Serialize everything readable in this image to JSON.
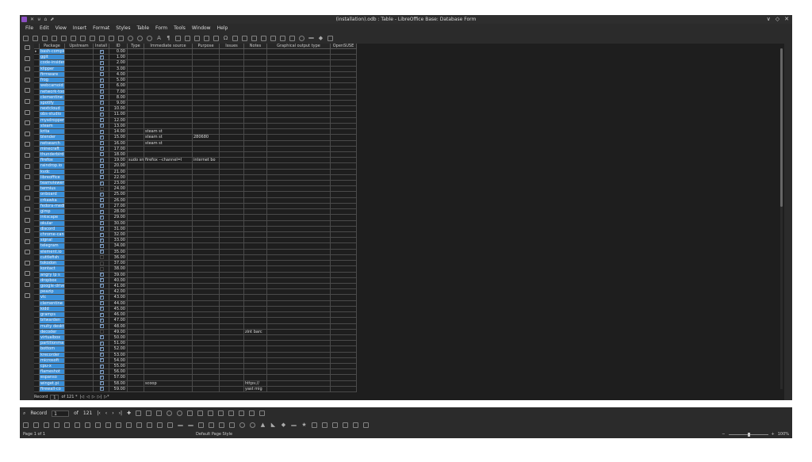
{
  "window": {
    "title": "(installation).odb : Table - LibreOffice Base: Database Form",
    "controls": [
      "∨",
      "◇",
      "✕"
    ]
  },
  "menu": [
    "File",
    "Edit",
    "View",
    "Insert",
    "Format",
    "Styles",
    "Table",
    "Form",
    "Tools",
    "Window",
    "Help"
  ],
  "table": {
    "columns": [
      "Package",
      "Upstream",
      "Install",
      "ID",
      "Type",
      "Immediate source",
      "Purpose",
      "Issues",
      "Notes",
      "Graphical output type",
      "OpenSUSE"
    ],
    "rows": [
      {
        "package": "bash-completion",
        "install": true,
        "id": "0.00"
      },
      {
        "package": "ggit",
        "install": true,
        "id": "1.00"
      },
      {
        "package": "code-insiders",
        "install": true,
        "id": "2.00"
      },
      {
        "package": "klipper",
        "install": true,
        "id": "3.00"
      },
      {
        "package": "firmware",
        "install": true,
        "id": "4.00"
      },
      {
        "package": "frog",
        "install": true,
        "id": "5.00"
      },
      {
        "package": "webcamoid",
        "install": true,
        "id": "6.00"
      },
      {
        "package": "network-tools",
        "install": true,
        "id": "7.00"
      },
      {
        "package": "clementine",
        "install": true,
        "id": "8.00"
      },
      {
        "package": "spotify",
        "install": true,
        "id": "9.00"
      },
      {
        "package": "nextcloud",
        "install": true,
        "id": "10.00"
      },
      {
        "package": "obs-studio",
        "install": true,
        "id": "11.00"
      },
      {
        "package": "mysdropper",
        "install": true,
        "id": "12.00"
      },
      {
        "package": "steam",
        "install": true,
        "id": "13.00"
      },
      {
        "package": "krita",
        "install": true,
        "id": "14.00",
        "source": "steam st"
      },
      {
        "package": "blender",
        "install": true,
        "id": "15.00",
        "source": "steam st",
        "purpose": "280680"
      },
      {
        "package": "netsearch",
        "install": true,
        "id": "16.00",
        "source": "steam st"
      },
      {
        "package": "minecraft",
        "install": true,
        "id": "17.00"
      },
      {
        "package": "thunderbird",
        "install": true,
        "id": "18.00"
      },
      {
        "package": "firefox",
        "install": true,
        "id": "19.00",
        "type": "sudo sn",
        "source": "firefox --channel=l",
        "purpose": "internet bo"
      },
      {
        "package": "raindrop.io",
        "install": true,
        "id": "20.00"
      },
      {
        "package": "kvdc",
        "install": true,
        "id": "21.00"
      },
      {
        "package": "libreoffice",
        "install": true,
        "id": "22.00"
      },
      {
        "package": "teamviewer",
        "install": true,
        "id": "23.00"
      },
      {
        "package": "termius",
        "install": false,
        "id": "24.00"
      },
      {
        "package": "onboard",
        "install": true,
        "id": "25.00"
      },
      {
        "package": "crkawka",
        "install": true,
        "id": "26.00"
      },
      {
        "package": "fedora-media",
        "install": true,
        "id": "27.00"
      },
      {
        "package": "gimp",
        "install": true,
        "id": "28.00"
      },
      {
        "package": "inkscape",
        "install": true,
        "id": "29.00"
      },
      {
        "package": "okular",
        "install": true,
        "id": "30.00"
      },
      {
        "package": "discord",
        "install": true,
        "id": "31.00"
      },
      {
        "package": "chrome-canary",
        "install": true,
        "id": "32.00"
      },
      {
        "package": "signal",
        "install": true,
        "id": "33.00"
      },
      {
        "package": "telegram",
        "install": true,
        "id": "34.00"
      },
      {
        "package": "element.io",
        "install": true,
        "id": "35.00"
      },
      {
        "package": "cuttlefish",
        "install": false,
        "id": "36.00"
      },
      {
        "package": "tokodon",
        "install": false,
        "id": "37.00"
      },
      {
        "package": "kontact",
        "install": false,
        "id": "38.00"
      },
      {
        "package": "angry ip s",
        "install": true,
        "id": "39.00"
      },
      {
        "package": "dropbox",
        "install": true,
        "id": "40.00"
      },
      {
        "package": "google-drive",
        "install": true,
        "id": "41.00"
      },
      {
        "package": "peazip",
        "install": true,
        "id": "42.00"
      },
      {
        "package": "vlc",
        "install": true,
        "id": "43.00"
      },
      {
        "package": "clementine",
        "install": true,
        "id": "44.00"
      },
      {
        "package": "kidd",
        "install": true,
        "id": "45.00"
      },
      {
        "package": "gramps",
        "install": true,
        "id": "46.00"
      },
      {
        "package": "bitwarden",
        "install": true,
        "id": "47.00"
      },
      {
        "package": "multy deskt",
        "install": true,
        "id": "48.00"
      },
      {
        "package": "decoder",
        "install": false,
        "id": "49.00",
        "notes": "zint barc"
      },
      {
        "package": "virtualbox",
        "install": true,
        "id": "50.00"
      },
      {
        "package": "partitionma",
        "install": true,
        "id": "51.00"
      },
      {
        "package": "bottom",
        "install": true,
        "id": "52.00"
      },
      {
        "package": "krecorder",
        "install": true,
        "id": "53.00"
      },
      {
        "package": "microsoft",
        "install": true,
        "id": "54.00"
      },
      {
        "package": "cpu-x",
        "install": true,
        "id": "55.00"
      },
      {
        "package": "flameshot",
        "install": true,
        "id": "56.00"
      },
      {
        "package": "espanso",
        "install": true,
        "id": "57.00"
      },
      {
        "package": "winget.pi",
        "install": true,
        "id": "58.00",
        "source": "scoop",
        "notes": "https://"
      },
      {
        "package": "firewall-co",
        "install": true,
        "id": "59.00",
        "notes": "yast mig"
      }
    ]
  },
  "record_nav": {
    "label": "Record",
    "current": "1",
    "of_text": "of 121 *"
  },
  "form_nav": {
    "label": "Record",
    "current": "1",
    "of_text": "of",
    "total": "121"
  },
  "status": {
    "page": "Page 1 of 1",
    "page_style": "Default Page Style",
    "zoom": "100%"
  },
  "colors": {
    "selected_cell": "#3a8fd8",
    "background": "#1e1e1e"
  }
}
